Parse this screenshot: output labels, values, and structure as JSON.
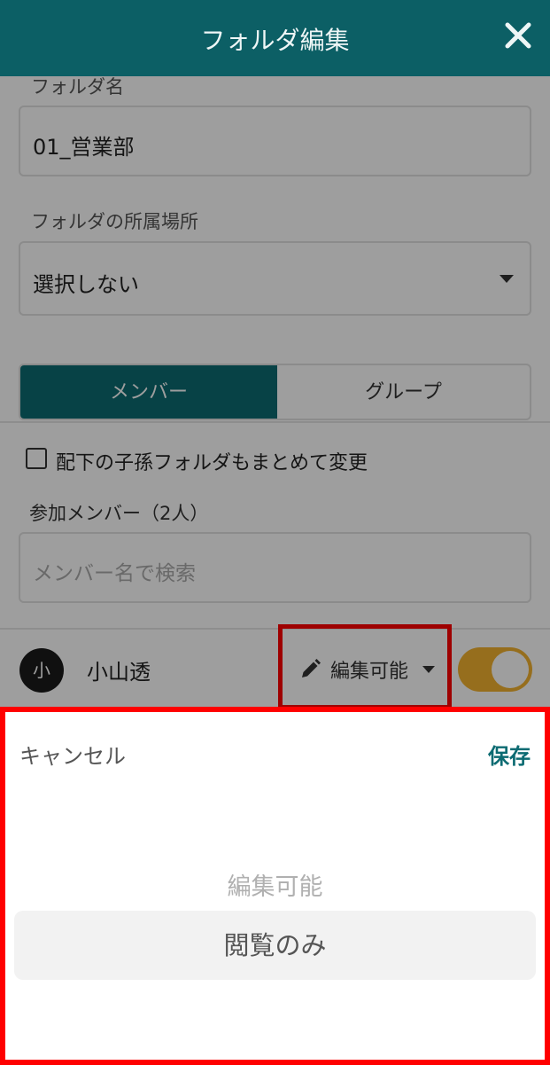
{
  "header": {
    "title": "フォルダ編集",
    "close_glyph": "✕"
  },
  "form": {
    "folder_name_label": "フォルダ名",
    "folder_name_value": "01_営業部",
    "location_label": "フォルダの所属場所",
    "location_value": "選択しない"
  },
  "tabs": {
    "members": "メンバー",
    "groups": "グループ"
  },
  "options": {
    "cascade_label": "配下の子孫フォルダもまとめて変更"
  },
  "members": {
    "heading": "参加メンバー（2人）",
    "search_placeholder": "メンバー名で検索",
    "list": [
      {
        "avatar": "小",
        "name": "小山透",
        "permission": "編集可能",
        "enabled": true
      }
    ]
  },
  "picker": {
    "cancel_label": "キャンセル",
    "save_label": "保存",
    "options": [
      "編集可能",
      "閲覧のみ"
    ],
    "selected": "閲覧のみ"
  },
  "colors": {
    "header": "#0c5f65",
    "accent": "#0c6b72",
    "toggle": "#f2b230",
    "highlight": "#ff0000"
  },
  "icons": [
    "close-icon",
    "caret-down-icon",
    "checkbox-icon",
    "pencil-icon",
    "toggle-switch"
  ]
}
